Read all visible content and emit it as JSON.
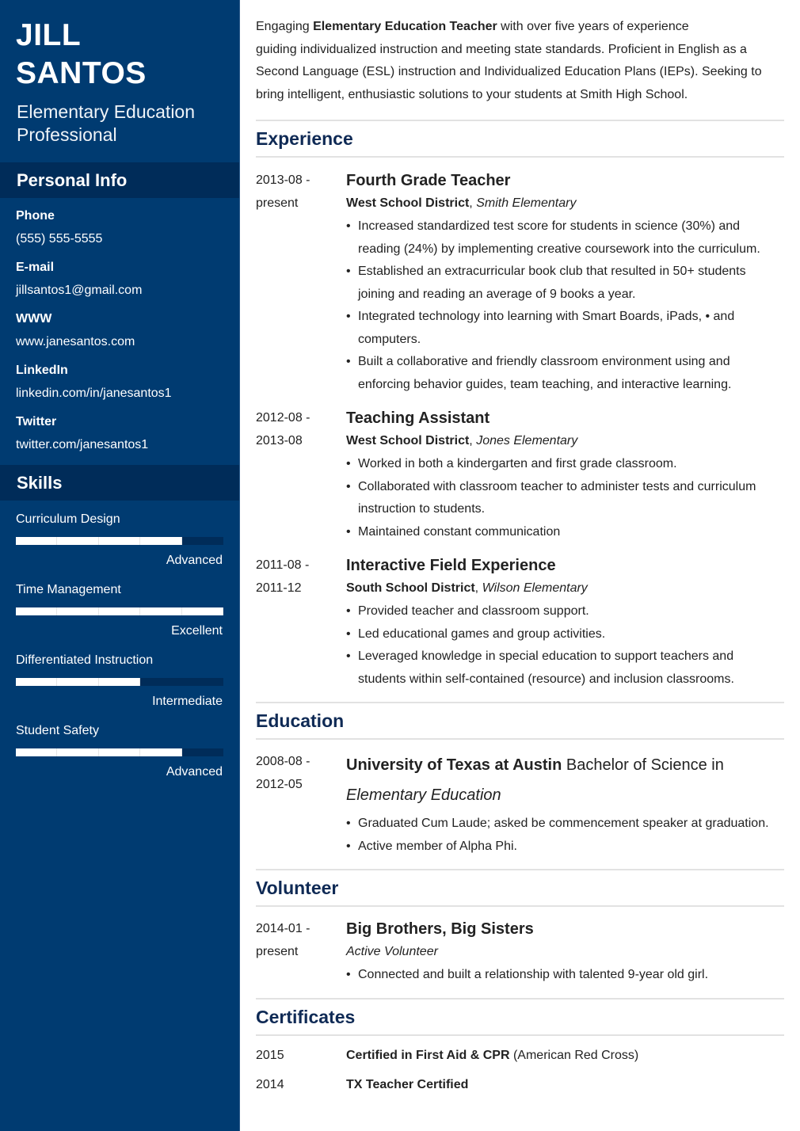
{
  "profile": {
    "first_name": "JILL",
    "last_name": "SANTOS",
    "title": "Elementary Education Professional"
  },
  "theme": {
    "sidebar_color": "#003b71",
    "sidebar_header_color": "#002c59",
    "heading_color": "#0f2a55"
  },
  "personal_info": {
    "heading": "Personal Info",
    "items": [
      {
        "label": "Phone",
        "value": "(555) 555-5555"
      },
      {
        "label": "E-mail",
        "value": "jillsantos1@gmail.com"
      },
      {
        "label": "WWW",
        "value": "www.janesantos.com"
      },
      {
        "label": "LinkedIn",
        "value": "linkedin.com/in/janesantos1"
      },
      {
        "label": "Twitter",
        "value": "twitter.com/janesantos1"
      }
    ]
  },
  "skills": {
    "heading": "Skills",
    "max_level": 5,
    "items": [
      {
        "name": "Curriculum Design",
        "level": 4,
        "level_label": "Advanced"
      },
      {
        "name": "Time Management",
        "level": 5,
        "level_label": "Excellent"
      },
      {
        "name": "Differentiated Instruction",
        "level": 3,
        "level_label": "Intermediate"
      },
      {
        "name": "Student Safety",
        "level": 4,
        "level_label": "Advanced"
      }
    ]
  },
  "summary": {
    "prefix": "Engaging ",
    "bold": "Elementary Education Teacher",
    "line1_rest": " with over five years of experience",
    "rest": "guiding individualized instruction and meeting state standards. Proficient in English as a Second Language (ESL) instruction and Individualized Education Plans (IEPs). Seeking to bring intelligent, enthusiastic solutions to your students at Smith High School."
  },
  "experience": {
    "heading": "Experience",
    "entries": [
      {
        "date_start": "2013-08 -",
        "date_end": "present",
        "title": "Fourth Grade Teacher",
        "org": "West School District",
        "location": "Smith Elementary",
        "bullets": [
          "Increased standardized test score for students in science (30%) and reading (24%) by implementing creative coursework into the curriculum.",
          "Established an extracurricular book club that resulted in 50+ students joining and reading an average of 9 books a year.",
          "Integrated technology into learning with Smart Boards, iPads, • and computers.",
          "Built a collaborative and friendly classroom environment using and enforcing behavior guides, team teaching, and interactive learning."
        ]
      },
      {
        "date_start": "2012-08 -",
        "date_end": "2013-08",
        "title": "Teaching Assistant",
        "org": "West School District",
        "location": "Jones Elementary",
        "bullets": [
          "Worked in both a kindergarten and first grade classroom.",
          "Collaborated with classroom teacher to administer tests and curriculum instruction to students.",
          "Maintained constant communication"
        ]
      },
      {
        "date_start": "2011-08 -",
        "date_end": "2011-12",
        "title": "Interactive Field Experience",
        "org": "South School District",
        "location": "Wilson Elementary",
        "bullets": [
          "Provided teacher and classroom support.",
          "Led educational games and group activities.",
          "Leveraged knowledge in special education to support teachers and students within self-contained (resource) and inclusion classrooms."
        ]
      }
    ]
  },
  "education": {
    "heading": "Education",
    "entries": [
      {
        "date_start": "2008-08 -",
        "date_end": "2012-05",
        "school": "University of Texas at Austin",
        "degree": " Bachelor of Science in",
        "field": "Elementary Education",
        "bullets": [
          "Graduated Cum Laude; asked be commencement speaker at graduation.",
          "Active member of Alpha Phi."
        ]
      }
    ]
  },
  "volunteer": {
    "heading": "Volunteer",
    "entries": [
      {
        "date_start": "2014-01 -",
        "date_end": "present",
        "title": "Big Brothers, Big Sisters",
        "role": "Active Volunteer",
        "bullets": [
          "Connected and built a relationship with talented 9-year old girl."
        ]
      }
    ]
  },
  "certificates": {
    "heading": "Certificates",
    "entries": [
      {
        "year": "2015",
        "name": "Certified in First Aid & CPR",
        "issuer": " (American Red Cross)"
      },
      {
        "year": "2014",
        "name": "TX Teacher Certified",
        "issuer": ""
      }
    ]
  }
}
